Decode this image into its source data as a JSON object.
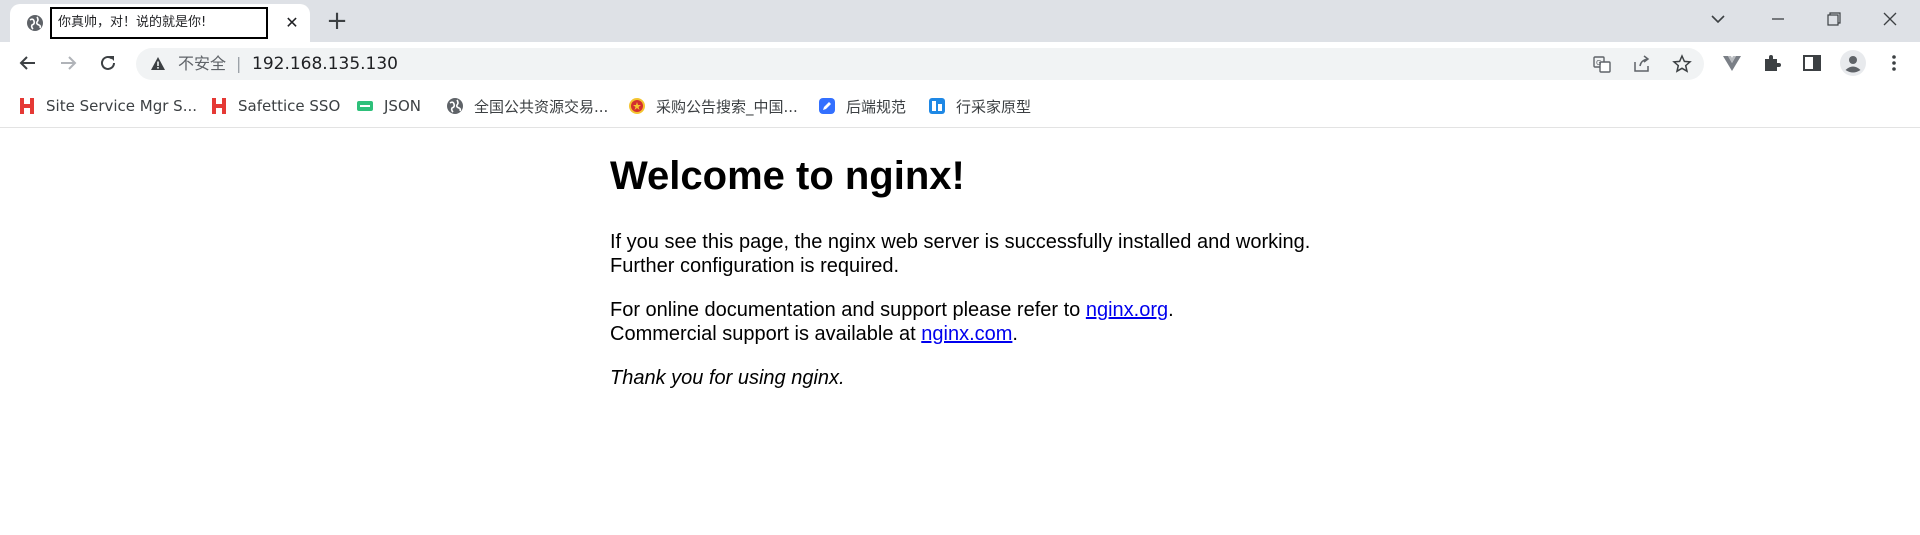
{
  "tab": {
    "title": "你真帅，对！说的就是你!",
    "favicon": "globe-icon",
    "close_symbol": "✕",
    "new_tab_symbol": "+"
  },
  "window_controls": [
    "chevron-down-icon",
    "minimize-icon",
    "restore-icon",
    "close-icon"
  ],
  "toolbar": {
    "security_label": "不安全",
    "divider": "|",
    "url": "192.168.135.130",
    "omnibox_icons": [
      "translate-icon",
      "share-icon",
      "star-icon"
    ],
    "extension_icons": [
      "vue-devtools-icon",
      "puzzle-icon",
      "side-panel-icon",
      "profile-icon",
      "menu-dots-icon"
    ]
  },
  "bookmarks": [
    {
      "label": "Site Service Mgr S...",
      "icon": "h-logo-icon",
      "color": "#e53935"
    },
    {
      "label": "Safettice SSO",
      "icon": "h-logo-icon",
      "color": "#e53935"
    },
    {
      "label": "JSON",
      "icon": "json-icon",
      "color": "#2ec07a"
    },
    {
      "label": "全国公共资源交易...",
      "icon": "globe-icon",
      "color": "#5f6368"
    },
    {
      "label": "采购公告搜索_中国...",
      "icon": "emblem-icon",
      "color": "#d32f2f"
    },
    {
      "label": "后端规范",
      "icon": "doc-edit-icon",
      "color": "#3370ff"
    },
    {
      "label": "行采家原型",
      "icon": "prototype-icon",
      "color": "#1e88e5"
    }
  ],
  "page": {
    "heading": "Welcome to nginx!",
    "para1": "If you see this page, the nginx web server is successfully installed and working. Further configuration is required.",
    "para2_text_a": "For online documentation and support please refer to ",
    "link_org": "nginx.org",
    "para2_text_b": ".",
    "para2_text_c": "Commercial support is available at ",
    "link_com": "nginx.com",
    "para2_text_d": ".",
    "thanks": "Thank you for using nginx."
  }
}
